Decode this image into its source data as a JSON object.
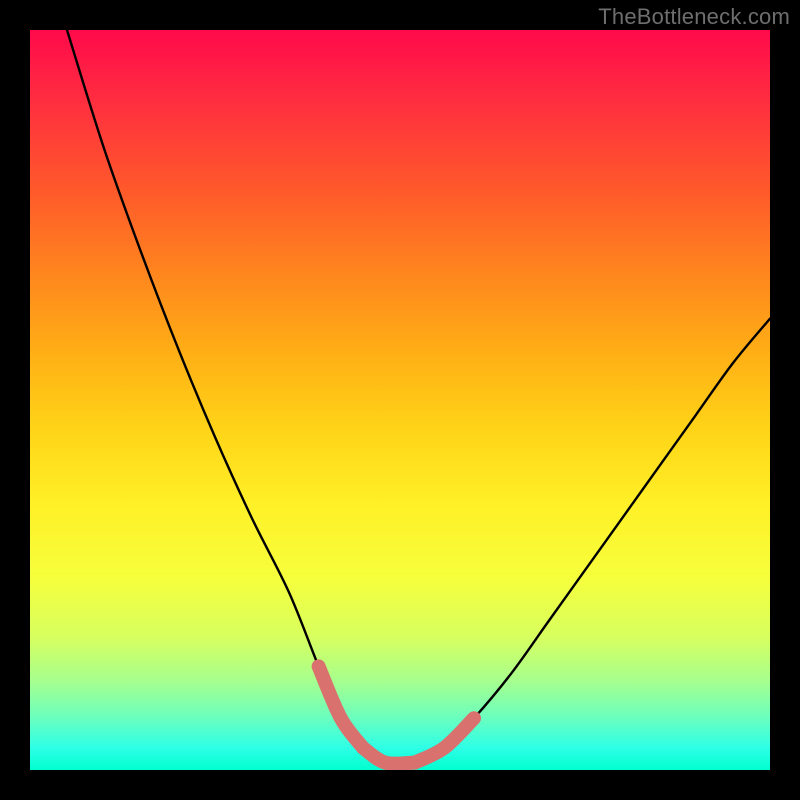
{
  "watermark": {
    "text": "TheBottleneck.com"
  },
  "colors": {
    "background": "#000000",
    "curve_stroke": "#000000",
    "highlight_stroke": "#d9716e",
    "gradient_stops": [
      "#ff0a4b",
      "#ff2f3f",
      "#ff5a2a",
      "#ff8a1d",
      "#ffb015",
      "#ffd418",
      "#fff027",
      "#f6ff3c",
      "#d7ff5f",
      "#a6ff8e",
      "#6affbf",
      "#2effe6",
      "#00ffd0"
    ]
  },
  "chart_data": {
    "type": "line",
    "title": "",
    "xlabel": "",
    "ylabel": "",
    "xlim": [
      0,
      100
    ],
    "ylim": [
      0,
      100
    ],
    "grid": false,
    "series": [
      {
        "name": "bottleneck-curve",
        "x": [
          5,
          10,
          15,
          20,
          25,
          30,
          35,
          39,
          42,
          45,
          48,
          52,
          56,
          60,
          65,
          70,
          75,
          80,
          85,
          90,
          95,
          100
        ],
        "values": [
          100,
          84,
          70,
          57,
          45,
          34,
          24,
          14,
          7,
          3,
          1,
          1,
          3,
          7,
          13,
          20,
          27,
          34,
          41,
          48,
          55,
          61
        ]
      }
    ],
    "highlight_segments": [
      {
        "name": "left-highlight",
        "x_range": [
          39,
          45
        ],
        "y_range": [
          14,
          3
        ]
      },
      {
        "name": "flat-highlight",
        "x_range": [
          45,
          52
        ],
        "y_range": [
          1,
          1
        ]
      },
      {
        "name": "right-highlight",
        "x_range": [
          52,
          60
        ],
        "y_range": [
          1,
          7
        ]
      }
    ],
    "annotations": []
  }
}
